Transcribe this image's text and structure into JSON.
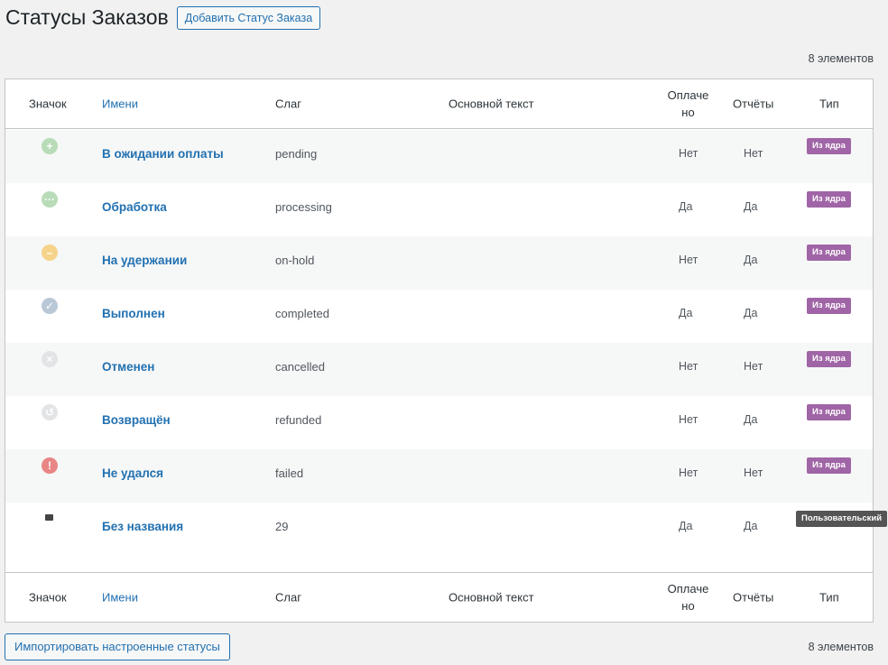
{
  "header": {
    "title": "Статусы Заказов",
    "add_button": "Добавить Статус Заказа"
  },
  "item_count": "8 элементов",
  "columns": {
    "icon": "Значок",
    "name": "Имени",
    "slug": "Слаг",
    "text": "Основной текст",
    "paid": "Оплаче но",
    "reports": "Отчёты",
    "type": "Тип"
  },
  "rows": [
    {
      "icon": "plus-circle-icon",
      "name": "В ожидании оплаты",
      "slug": "pending",
      "paid": "Нет",
      "reports": "Нет",
      "type": "Из ядра"
    },
    {
      "icon": "dots-circle-icon",
      "name": "Обработка",
      "slug": "processing",
      "paid": "Да",
      "reports": "Да",
      "type": "Из ядра"
    },
    {
      "icon": "minus-circle-icon",
      "name": "На удержании",
      "slug": "on-hold",
      "paid": "Нет",
      "reports": "Да",
      "type": "Из ядра"
    },
    {
      "icon": "check-circle-icon",
      "name": "Выполнен",
      "slug": "completed",
      "paid": "Да",
      "reports": "Да",
      "type": "Из ядра"
    },
    {
      "icon": "x-circle-icon",
      "name": "Отменен",
      "slug": "cancelled",
      "paid": "Нет",
      "reports": "Нет",
      "type": "Из ядра"
    },
    {
      "icon": "refund-circle-icon",
      "name": "Возвращён",
      "slug": "refunded",
      "paid": "Нет",
      "reports": "Да",
      "type": "Из ядра"
    },
    {
      "icon": "exclamation-circle-icon",
      "name": "Не удался",
      "slug": "failed",
      "paid": "Нет",
      "reports": "Нет",
      "type": "Из ядра"
    },
    {
      "icon": "square-icon",
      "name": "Без названия",
      "slug": "29",
      "paid": "Да",
      "reports": "Да",
      "type": "Пользовательский"
    }
  ],
  "import_button": "Импортировать настроенные статусы",
  "colors": {
    "accent": "#2271b1",
    "core_badge": "#a065a6",
    "custom_badge": "#555555"
  }
}
